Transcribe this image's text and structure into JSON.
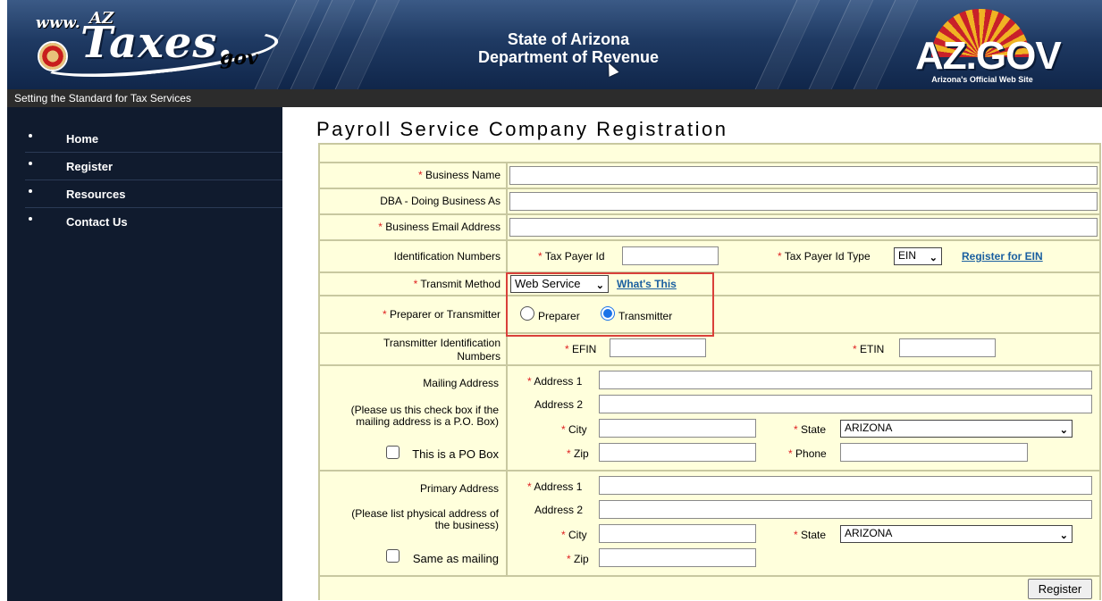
{
  "header": {
    "logo_www": "www.",
    "logo_az": "AZ",
    "logo_taxes": "Taxes.",
    "logo_gov": "gov",
    "dept_line1": "State of Arizona",
    "dept_line2": "Department of Revenue",
    "azgov_text": "AZ.GOV",
    "azgov_sub": "Arizona's Official Web Site",
    "tagline": "Setting the Standard for Tax Services"
  },
  "sidebar": {
    "items": [
      {
        "label": "Home"
      },
      {
        "label": "Register"
      },
      {
        "label": "Resources"
      },
      {
        "label": "Contact Us"
      }
    ]
  },
  "page_title": "Payroll Service Company Registration",
  "form": {
    "required_marker": "*",
    "business_name_label": "Business Name",
    "dba_label": "DBA - Doing Business As",
    "email_label": "Business Email Address",
    "id_numbers_label": "Identification Numbers",
    "tax_payer_id_label": "Tax Payer Id",
    "tax_payer_id_type_label": "Tax Payer Id Type",
    "tax_payer_id_type_value": "EIN",
    "register_ein_link": "Register for EIN",
    "transmit_method_label": "Transmit Method",
    "transmit_method_value": "Web Service",
    "whats_this_link": "What's This",
    "preparer_transmitter_label": "Preparer or Transmitter",
    "preparer_option": "Preparer",
    "transmitter_option": "Transmitter",
    "selected_option": "Transmitter",
    "transmitter_id_label_1": "Transmitter Identification",
    "transmitter_id_label_2": "Numbers",
    "efin_label": "EFIN",
    "etin_label": "ETIN",
    "mailing": {
      "title": "Mailing Address",
      "note_1": "(Please us this check box if the",
      "note_2": "mailing address is a P.O. Box)",
      "checkbox_label": "This is a PO Box",
      "address1_label": "Address 1",
      "address2_label": "Address 2",
      "city_label": "City",
      "state_label": "State",
      "state_value": "ARIZONA",
      "zip_label": "Zip",
      "phone_label": "Phone"
    },
    "primary": {
      "title": "Primary Address",
      "note_1": "(Please list physical address of",
      "note_2": "the business)",
      "checkbox_label": "Same as mailing",
      "address1_label": "Address 1",
      "address2_label": "Address 2",
      "city_label": "City",
      "state_label": "State",
      "state_value": "ARIZONA",
      "zip_label": "Zip"
    },
    "register_button": "Register"
  },
  "colors": {
    "header_navy": "#1f3a63",
    "sidebar_bg": "#101b2e",
    "form_cell": "#ffffdc",
    "form_border": "#c8c8a0",
    "required": "#e02020",
    "link": "#1a5fa0",
    "highlight_box": "#d9403a"
  }
}
